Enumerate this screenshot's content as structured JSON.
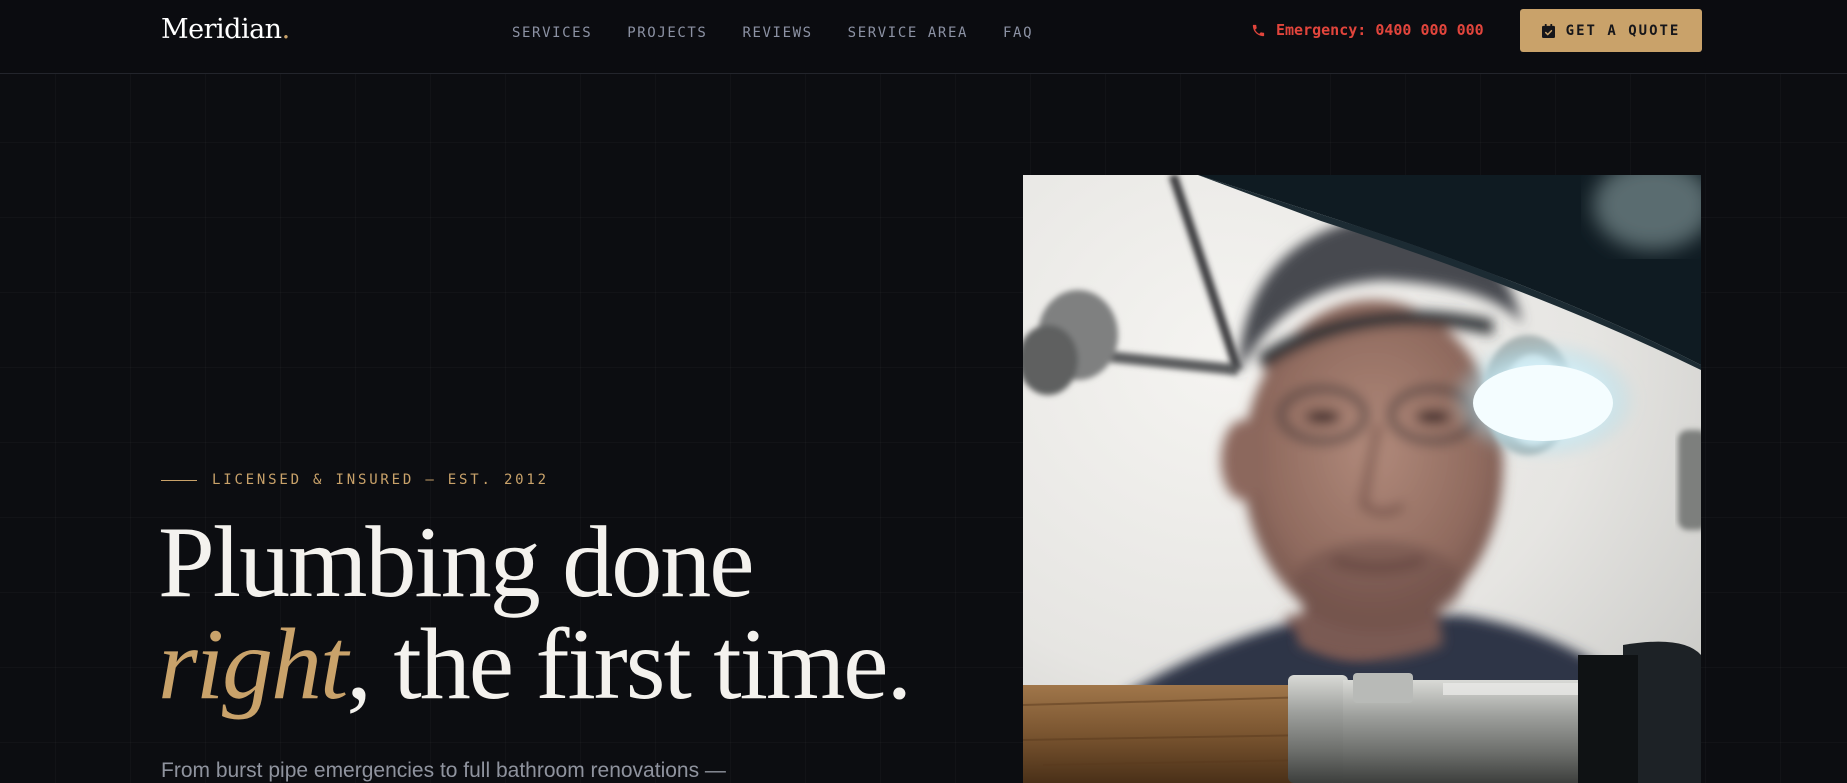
{
  "brand": {
    "name": "Meridian",
    "dot": "."
  },
  "nav": {
    "items": [
      {
        "label": "SERVICES"
      },
      {
        "label": "PROJECTS"
      },
      {
        "label": "REVIEWS"
      },
      {
        "label": "SERVICE AREA"
      },
      {
        "label": "FAQ"
      }
    ]
  },
  "header": {
    "emergency_label": "Emergency: 0400 000 000",
    "emergency_icon": "phone-icon",
    "cta_label": "GET A QUOTE",
    "cta_icon": "calendar-icon"
  },
  "hero": {
    "eyebrow": "LICENSED & INSURED — EST. 2012",
    "headline_line1": "Plumbing done",
    "headline_emphasis": "right",
    "headline_line2_rest": ", the first time.",
    "subtext": "From burst pipe emergencies to full bathroom renovations —",
    "image_alt": "Plumber wearing a cap and head torch looking up while working on a pipe"
  },
  "colors": {
    "background": "#0c0d11",
    "accent_gold": "#c9a26a",
    "emergency_red": "#e2453c",
    "nav_text": "#8c92a4",
    "body_text": "#8f939e"
  }
}
